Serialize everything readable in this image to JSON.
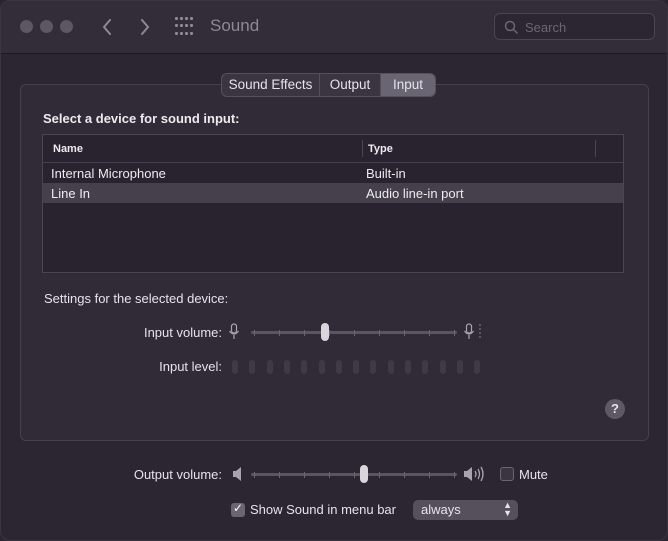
{
  "window": {
    "title": "Sound"
  },
  "search": {
    "placeholder": "Search"
  },
  "tabs": [
    {
      "label": "Sound Effects",
      "active": false
    },
    {
      "label": "Output",
      "active": false
    },
    {
      "label": "Input",
      "active": true
    }
  ],
  "input": {
    "heading": "Select a device for sound input:",
    "columns": [
      "Name",
      "Type"
    ],
    "devices": [
      {
        "name": "Internal Microphone",
        "type": "Built-in",
        "selected": false
      },
      {
        "name": "Line In",
        "type": "Audio line-in port",
        "selected": true
      }
    ],
    "settings_label": "Settings for the selected device:",
    "input_volume_label": "Input volume:",
    "input_volume_value": 0.36,
    "input_level_label": "Input level:",
    "input_level_segments": 15
  },
  "output": {
    "volume_label": "Output volume:",
    "volume_value": 0.55,
    "mute_label": "Mute",
    "mute_checked": false,
    "show_in_menubar_label": "Show Sound in menu bar",
    "show_in_menubar_checked": true,
    "menubar_option": "always"
  },
  "icons": {
    "back": "chevron-left-icon",
    "forward": "chevron-right-icon",
    "show_all": "grid-icon",
    "search": "magnifier-icon",
    "help": "question-mark-icon"
  }
}
